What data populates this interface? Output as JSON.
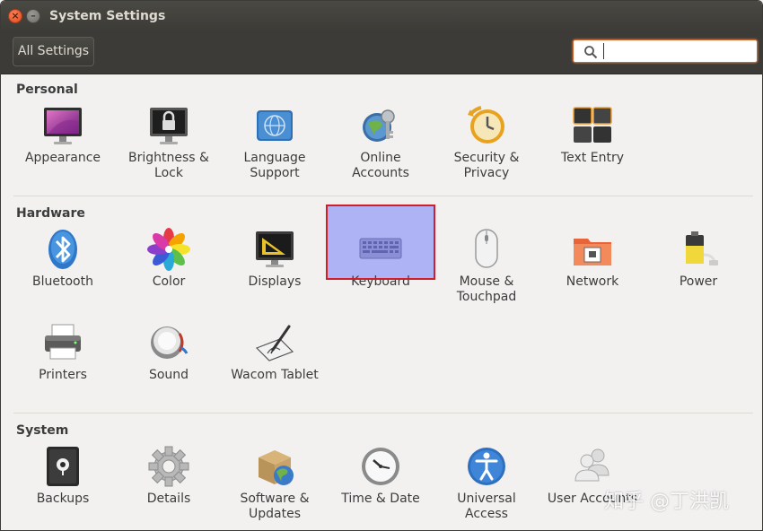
{
  "window": {
    "title": "System Settings"
  },
  "toolbar": {
    "all_settings_label": "All Settings",
    "search_value": "",
    "search_placeholder": ""
  },
  "sections": {
    "personal": {
      "title": "Personal",
      "items": [
        {
          "label": "Appearance",
          "icon": "appearance-icon"
        },
        {
          "label": "Brightness &\nLock",
          "icon": "brightness-lock-icon"
        },
        {
          "label": "Language\nSupport",
          "icon": "language-support-icon"
        },
        {
          "label": "Online\nAccounts",
          "icon": "online-accounts-icon"
        },
        {
          "label": "Security &\nPrivacy",
          "icon": "security-privacy-icon"
        },
        {
          "label": "Text Entry",
          "icon": "text-entry-icon"
        }
      ]
    },
    "hardware": {
      "title": "Hardware",
      "items": [
        {
          "label": "Bluetooth",
          "icon": "bluetooth-icon"
        },
        {
          "label": "Color",
          "icon": "color-icon"
        },
        {
          "label": "Displays",
          "icon": "displays-icon"
        },
        {
          "label": "Keyboard",
          "icon": "keyboard-icon",
          "selected": true
        },
        {
          "label": "Mouse &\nTouchpad",
          "icon": "mouse-icon"
        },
        {
          "label": "Network",
          "icon": "network-icon"
        },
        {
          "label": "Power",
          "icon": "power-icon"
        },
        {
          "label": "Printers",
          "icon": "printer-icon"
        },
        {
          "label": "Sound",
          "icon": "sound-icon"
        },
        {
          "label": "Wacom Tablet",
          "icon": "wacom-tablet-icon"
        }
      ]
    },
    "system": {
      "title": "System",
      "items": [
        {
          "label": "Backups",
          "icon": "backups-icon"
        },
        {
          "label": "Details",
          "icon": "details-icon"
        },
        {
          "label": "Software &\nUpdates",
          "icon": "software-updates-icon"
        },
        {
          "label": "Time & Date",
          "icon": "time-date-icon"
        },
        {
          "label": "Universal\nAccess",
          "icon": "universal-access-icon"
        },
        {
          "label": "User Accounts",
          "icon": "user-accounts-icon"
        }
      ]
    }
  },
  "watermark": "知乎 @丁洪凯",
  "colors": {
    "selected_bg": "#aeb3f5",
    "selected_border": "#d01e2b",
    "search_border": "#d8642a",
    "titlebar": "#3c3b37"
  }
}
